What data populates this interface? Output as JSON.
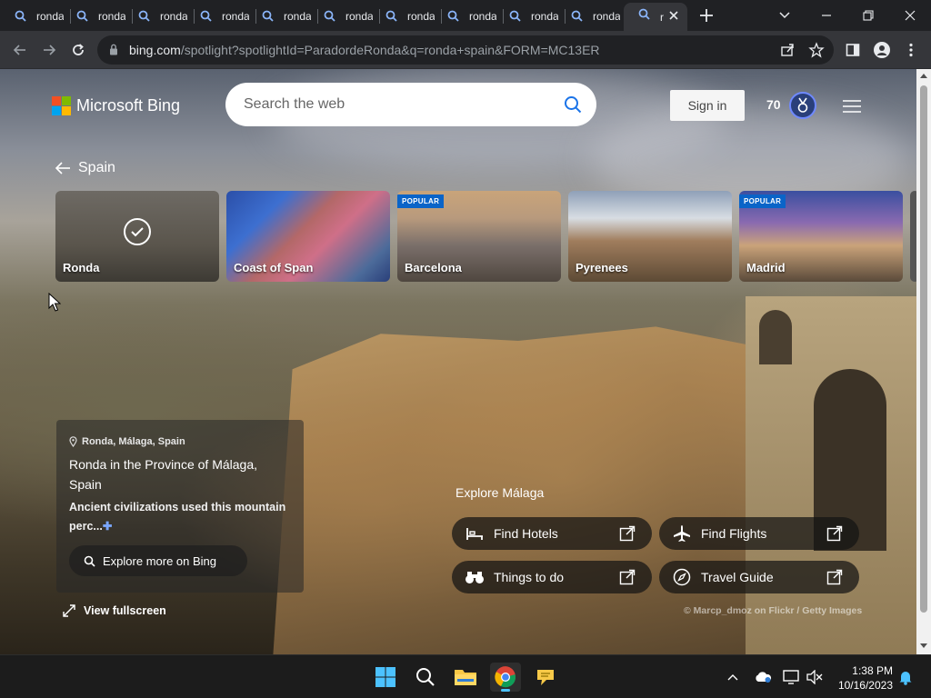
{
  "browser": {
    "tabs": [
      {
        "label": "ronda"
      },
      {
        "label": "ronda"
      },
      {
        "label": "ronda"
      },
      {
        "label": "ronda"
      },
      {
        "label": "ronda"
      },
      {
        "label": "ronda"
      },
      {
        "label": "ronda"
      },
      {
        "label": "ronda"
      },
      {
        "label": "ronda"
      },
      {
        "label": "ronda"
      },
      {
        "label": "r"
      }
    ],
    "url_host": "bing.com",
    "url_path": "/spotlight?spotlightId=ParadordeRonda&q=ronda+spain&FORM=MC13ER"
  },
  "bing": {
    "logo_text": "Microsoft Bing",
    "search_placeholder": "Search the web",
    "sign_in": "Sign in",
    "points": "70"
  },
  "breadcrumb": "Spain",
  "carousel": [
    {
      "label": "Ronda",
      "selected": true,
      "badge": ""
    },
    {
      "label": "Coast of Span",
      "selected": false,
      "badge": ""
    },
    {
      "label": "Barcelona",
      "selected": false,
      "badge": "POPULAR"
    },
    {
      "label": "Pyrenees",
      "selected": false,
      "badge": ""
    },
    {
      "label": "Madrid",
      "selected": false,
      "badge": "POPULAR"
    }
  ],
  "info": {
    "location": "Ronda, Málaga, Spain",
    "title": "Ronda in the Province of Málaga, Spain",
    "description": "Ancient civilizations used this mountain perc...",
    "explore_button": "Explore more on Bing",
    "fullscreen": "View fullscreen"
  },
  "explore": {
    "title": "Explore Málaga",
    "actions": [
      {
        "label": "Find Hotels",
        "icon": "bed-icon"
      },
      {
        "label": "Find Flights",
        "icon": "airplane-icon"
      },
      {
        "label": "Things to do",
        "icon": "binoculars-icon"
      },
      {
        "label": "Travel Guide",
        "icon": "compass-icon"
      }
    ]
  },
  "credit": "© Marcp_dmoz on Flickr / Getty Images",
  "taskbar": {
    "time": "1:38 PM",
    "date": "10/16/2023"
  },
  "colors": {
    "accent": "#0a64c8",
    "taskbar_accent": "#4cc2ff"
  }
}
